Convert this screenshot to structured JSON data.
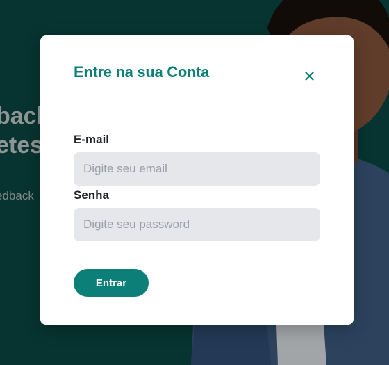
{
  "background": {
    "headline_line1": "back",
    "headline_line2": "etes",
    "subtext": "edback"
  },
  "modal": {
    "title": "Entre na sua Conta",
    "close_icon": "close-icon",
    "email": {
      "label": "E-mail",
      "placeholder": "Digite seu email",
      "value": ""
    },
    "password": {
      "label": "Senha",
      "placeholder": "Digite seu password",
      "value": ""
    },
    "submit_label": "Entrar"
  },
  "colors": {
    "accent": "#0b7f78",
    "page_background": "#0b4a45",
    "input_background": "#e6e7ea"
  }
}
